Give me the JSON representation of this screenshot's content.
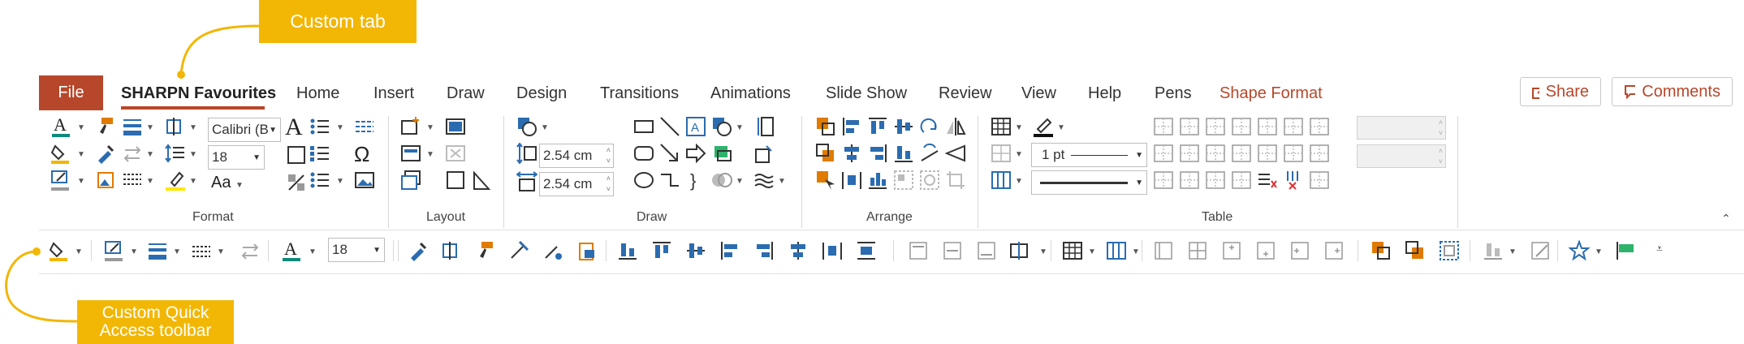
{
  "callouts": {
    "custom_tab": "Custom tab",
    "custom_qat_line1": "Custom Quick",
    "custom_qat_line2": "Access toolbar"
  },
  "tabs": {
    "file": "File",
    "sharpn": "SHARPN Favourites",
    "home": "Home",
    "insert": "Insert",
    "draw": "Draw",
    "design": "Design",
    "transitions": "Transitions",
    "animations": "Animations",
    "slideshow": "Slide Show",
    "review": "Review",
    "view": "View",
    "help": "Help",
    "pens": "Pens",
    "shapeformat": "Shape Format"
  },
  "actions": {
    "share": "Share",
    "comments": "Comments"
  },
  "ribbon": {
    "groups": {
      "format": "Format",
      "layout": "Layout",
      "draw": "Draw",
      "arrange": "Arrange",
      "table": "Table"
    },
    "font_name": "Calibri (B",
    "font_size": "18",
    "font_grow_label": "A",
    "change_case_label": "Aa",
    "height_value": "2.54 cm",
    "width_value": "2.54 cm",
    "pen_weight": "1 pt"
  },
  "qat": {
    "font_size": "18"
  },
  "colors": {
    "accent": "#b7472a",
    "callout": "#f2b705",
    "icon_blue": "#2b6cb0",
    "icon_orange": "#e07b00"
  }
}
